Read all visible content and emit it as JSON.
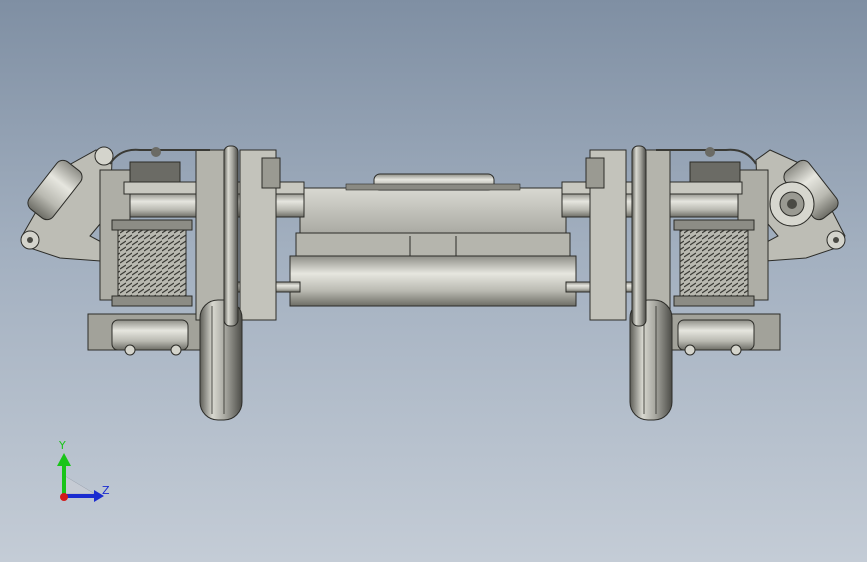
{
  "viewport": {
    "background_top": "#7f8fa3",
    "background_bottom": "#c4ccd6"
  },
  "model": {
    "description_icon": "bogie-wheelset-model",
    "steel_color": "#c9c9c2",
    "shadow_color": "#5e5e58",
    "outline_color": "#2c2c28"
  },
  "triad": {
    "y_label": "Y",
    "z_label": "Z",
    "y_color": "#19c419",
    "z_color": "#1a2bd0",
    "origin_color": "#d21a1a"
  }
}
